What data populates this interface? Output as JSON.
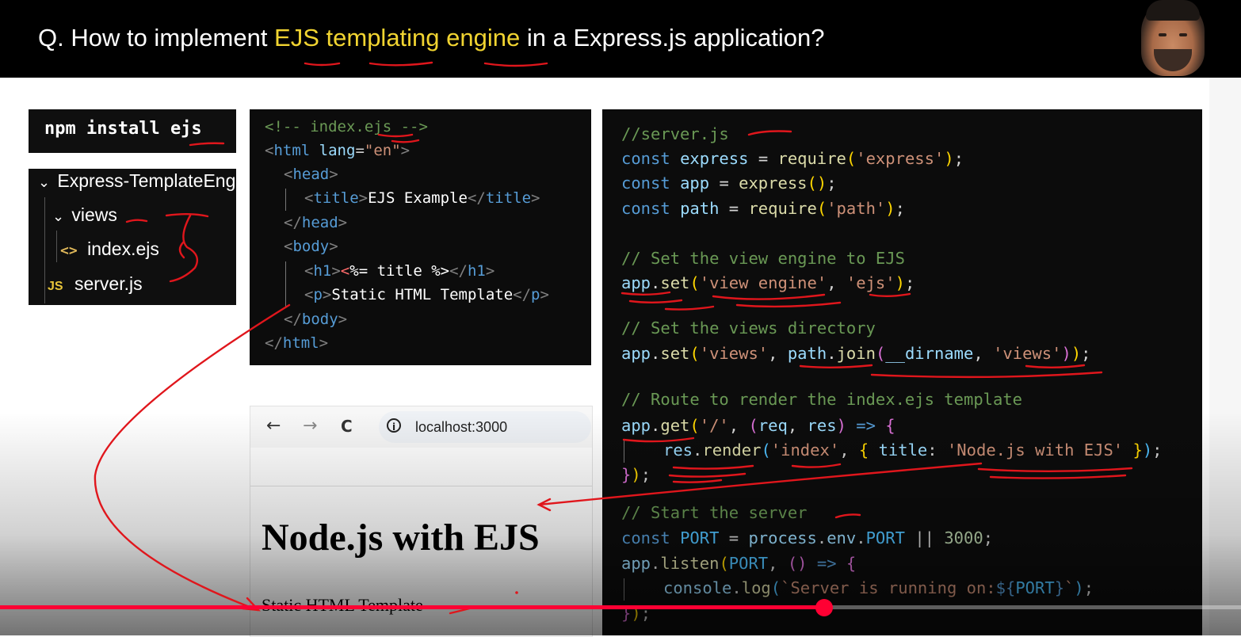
{
  "slide": {
    "title_parts": [
      "Q. How to implement ",
      "EJS templating engine",
      " in a Express.js application?"
    ]
  },
  "npm": {
    "command": "npm install ejs"
  },
  "explorer": {
    "root": "Express-TemplateEngine",
    "items": [
      {
        "icon": "chevron-down-icon",
        "label": "views"
      },
      {
        "icon": "code-brackets-icon",
        "icon_text": "<>",
        "label": "index.ejs"
      },
      {
        "icon": "js-file-icon",
        "icon_text": "JS",
        "label": "server.js"
      }
    ]
  },
  "html_code": {
    "lines": [
      "<!-- index.ejs -->",
      "<html lang=\"en\">",
      "  <head>",
      "    <title>EJS Example</title>",
      "  </head>",
      "  <body>",
      "    <h1><%= title %></h1>",
      "    <p>Static HTML Template</p>",
      "  </body>",
      "</html>"
    ]
  },
  "js_code": {
    "lines": [
      "//server.js",
      "const express = require('express');",
      "const app = express();",
      "const path = require('path');",
      "",
      "// Set the view engine to EJS",
      "app.set('view engine', 'ejs');",
      "",
      "// Set the views directory",
      "app.set('views', path.join(__dirname, 'views'));",
      "",
      "// Route to render the index.ejs template",
      "app.get('/', (req, res) => {",
      "    res.render('index', { title: 'Node.js with EJS' });",
      "});",
      "",
      "// Start the server",
      "const PORT = process.env.PORT || 3000;",
      "app.listen(PORT, () => {",
      "    console.log(`Server is running on:${PORT}`);",
      "});"
    ]
  },
  "browser": {
    "url": "localhost:3000",
    "back_icon": "←",
    "forward_icon": "→",
    "reload_icon": "C",
    "info_icon": "i",
    "heading": "Node.js with EJS",
    "paragraph": "Static HTML Template"
  },
  "player": {
    "progress_fraction": 0.664,
    "accent_color": "#ff0033"
  },
  "colors": {
    "title_highlight": "#f1d431",
    "annotation": "#e0161c"
  }
}
